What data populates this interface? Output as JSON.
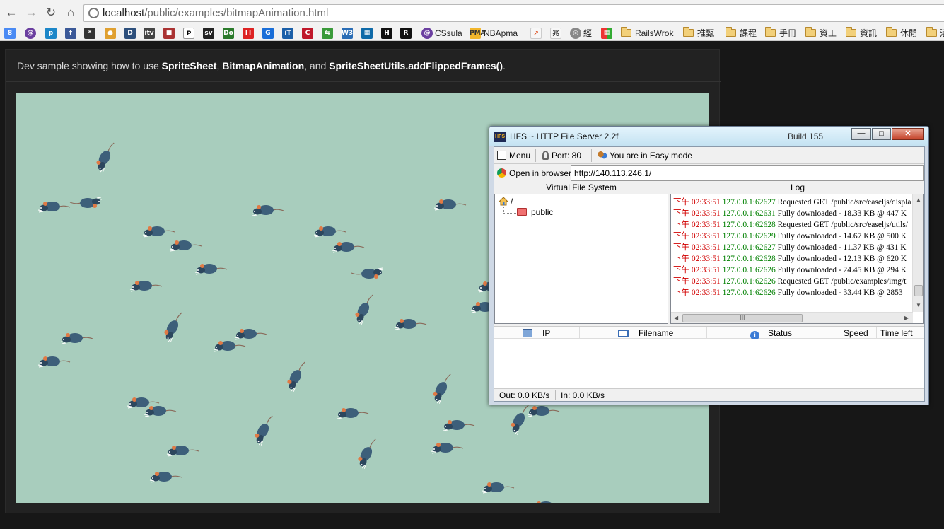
{
  "browser": {
    "url_host": "localhost",
    "url_path": "/public/examples/bitmapAnimation.html",
    "bookmarks": {
      "cssula": "CSsula",
      "nbapma": "NBApma",
      "jing": "經",
      "railswrok": "RailsWrok",
      "tuijian": "推甄",
      "kecheng": "課程",
      "shouce": "手冊",
      "zigong": "資工",
      "zixun": "資訊",
      "xiuxian": "休閒",
      "last": "活"
    }
  },
  "page": {
    "intro_prefix": "Dev sample showing how to use ",
    "spritesheet": "SpriteSheet",
    "sep1": ", ",
    "bitmapanimation": "BitmapAnimation",
    "sep2": ", and ",
    "addflipped": "SpriteSheetUtils.addFlippedFrames()",
    "suffix": "."
  },
  "hfs": {
    "title": "HFS ~ HTTP File Server 2.2f",
    "build": "Build 155",
    "toolbar": {
      "menu": "Menu",
      "port": "Port: 80",
      "mode": "You are in Easy mode"
    },
    "open_in_browser": "Open in browser",
    "url": "http://140.113.246.1/",
    "vfs_label": "Virtual File System",
    "log_label": "Log",
    "vfs_root": "/",
    "vfs_child": "public",
    "log": [
      {
        "t": "下午 02:33:51",
        "a": "127.0.0.1:62627",
        "m": "Requested GET /public/src/easeljs/displa"
      },
      {
        "t": "下午 02:33:51",
        "a": "127.0.0.1:62631",
        "m": "Fully downloaded - 18.33 KB @ 447 K"
      },
      {
        "t": "下午 02:33:51",
        "a": "127.0.0.1:62628",
        "m": "Requested GET /public/src/easeljs/utils/"
      },
      {
        "t": "下午 02:33:51",
        "a": "127.0.0.1:62629",
        "m": "Fully downloaded - 14.67 KB @ 500 K"
      },
      {
        "t": "下午 02:33:51",
        "a": "127.0.0.1:62627",
        "m": "Fully downloaded - 11.37 KB @ 431 K"
      },
      {
        "t": "下午 02:33:51",
        "a": "127.0.0.1:62628",
        "m": "Fully downloaded - 12.13 KB @ 620 K"
      },
      {
        "t": "下午 02:33:51",
        "a": "127.0.0.1:62626",
        "m": "Fully downloaded - 24.45 KB @ 294 K"
      },
      {
        "t": "下午 02:33:51",
        "a": "127.0.0.1:62626",
        "m": "Requested GET /public/examples/img/t"
      },
      {
        "t": "下午 02:33:51",
        "a": "127.0.0.1:62626",
        "m": "Fully downloaded - 33.44 KB @ 2853"
      }
    ],
    "hscroll_grip": "III",
    "columns": {
      "ip": "IP",
      "filename": "Filename",
      "status": "Status",
      "speed": "Speed",
      "timeleft": "Time left"
    },
    "status_out": "Out: 0.0 KB/s",
    "status_in": "In: 0.0 KB/s"
  },
  "colors": {
    "stage_bg": "#a8cdbd",
    "rat_body": "#3d5f7a",
    "rat_ear": "#e07a45",
    "log_time": "#d10000",
    "log_addr": "#008000"
  }
}
